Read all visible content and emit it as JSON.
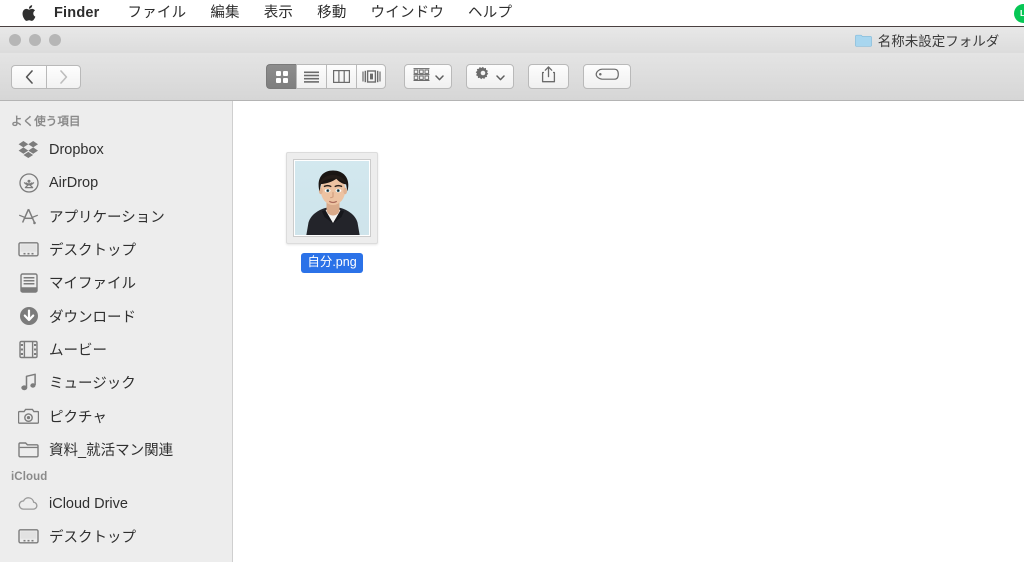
{
  "menubar": {
    "apple_icon": "apple-logo-icon",
    "app_name": "Finder",
    "items": [
      {
        "label": "ファイル"
      },
      {
        "label": "編集"
      },
      {
        "label": "表示"
      },
      {
        "label": "移動"
      },
      {
        "label": "ウインドウ"
      },
      {
        "label": "ヘルプ"
      }
    ],
    "status_items": [
      {
        "name": "line-status-icon",
        "label": "LI"
      }
    ]
  },
  "window": {
    "title": "名称未設定フォルダ",
    "title_icon": "folder-icon",
    "traffic_lights": [
      {
        "name": "close-button"
      },
      {
        "name": "minimize-button"
      },
      {
        "name": "zoom-button"
      }
    ]
  },
  "toolbar": {
    "nav": [
      {
        "name": "back-button",
        "icon": "chevron-left-icon",
        "enabled": true
      },
      {
        "name": "forward-button",
        "icon": "chevron-right-icon",
        "enabled": false
      }
    ],
    "view_buttons": [
      {
        "name": "icon-view-button",
        "icon": "grid-icon",
        "active": true
      },
      {
        "name": "list-view-button",
        "icon": "list-icon",
        "active": false
      },
      {
        "name": "column-view-button",
        "icon": "columns-icon",
        "active": false
      },
      {
        "name": "coverflow-view-button",
        "icon": "coverflow-icon",
        "active": false
      }
    ],
    "arrange_button": {
      "name": "arrange-button",
      "icon": "arrange-grid-icon"
    },
    "action_button": {
      "name": "action-button",
      "icon": "gear-icon"
    },
    "share_button": {
      "name": "share-button",
      "icon": "share-icon"
    },
    "tag_button": {
      "name": "tag-button",
      "icon": "tag-icon"
    }
  },
  "sidebar": {
    "sections": [
      {
        "header": "よく使う項目",
        "items": [
          {
            "label": "Dropbox",
            "icon": "dropbox-icon"
          },
          {
            "label": "AirDrop",
            "icon": "airdrop-icon"
          },
          {
            "label": "アプリケーション",
            "icon": "applications-icon"
          },
          {
            "label": "デスクトップ",
            "icon": "desktop-icon"
          },
          {
            "label": "マイファイル",
            "icon": "myfiles-icon"
          },
          {
            "label": "ダウンロード",
            "icon": "downloads-icon"
          },
          {
            "label": "ムービー",
            "icon": "movies-icon"
          },
          {
            "label": "ミュージック",
            "icon": "music-icon"
          },
          {
            "label": "ピクチャ",
            "icon": "pictures-icon"
          },
          {
            "label": "資料_就活マン関連",
            "icon": "folder-icon"
          }
        ]
      },
      {
        "header": "iCloud",
        "items": [
          {
            "label": "iCloud Drive",
            "icon": "cloud-icon"
          },
          {
            "label": "デスクトップ",
            "icon": "desktop-icon"
          }
        ]
      }
    ]
  },
  "content": {
    "files": [
      {
        "name": "自分.png",
        "kind": "image-thumbnail",
        "selected": true
      }
    ]
  },
  "colors": {
    "selection_blue": "#2b72e8",
    "sidebar_bg": "#ededed",
    "toolbar_bg": "#dcdcdc",
    "line_green": "#06c755",
    "photo_bg": "#cfe6ee"
  }
}
